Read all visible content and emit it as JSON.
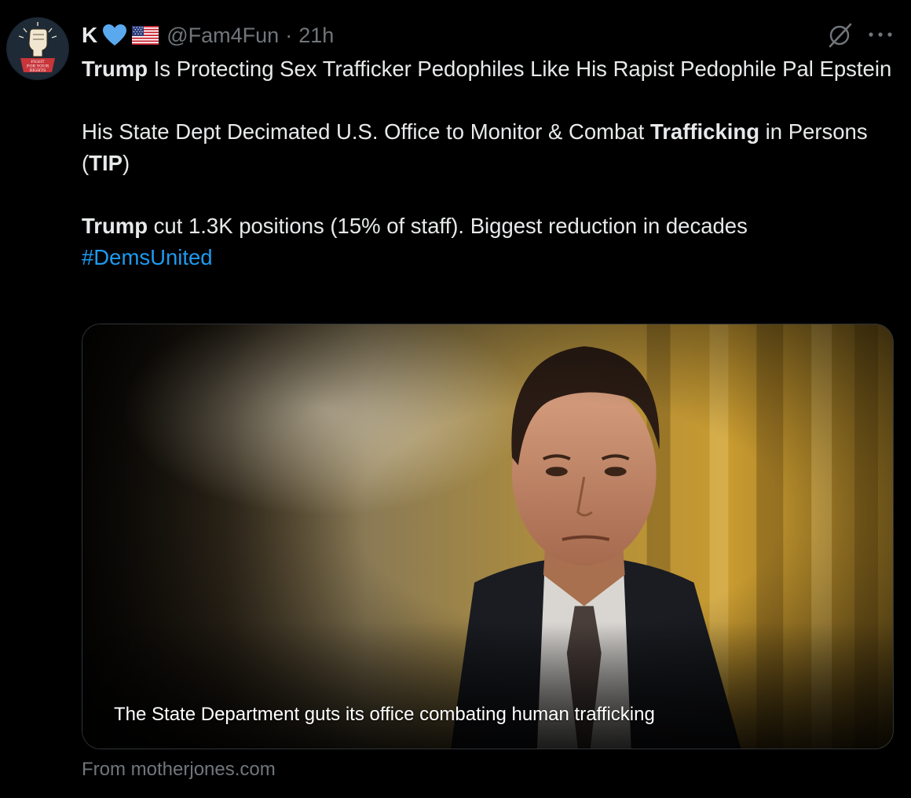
{
  "author": {
    "display_name": "K",
    "handle": "@Fam4Fun",
    "separator": "·",
    "time": "21h",
    "avatar_text": [
      "FIGHT",
      "FOR YOUR",
      "RIGHTS"
    ]
  },
  "tweet": {
    "line1_bold": "Trump",
    "line1_rest": " Is Protecting Sex Trafficker Pedophiles Like His Rapist Pedophile Pal Epstein",
    "line2_start": "His State Dept Decimated U.S. Office to Monitor & Combat ",
    "line2_bold": "Trafficking",
    "line2_mid": " in Persons (",
    "line2_bold2": "TIP",
    "line2_end": ")",
    "line3_bold": "Trump",
    "line3_rest": " cut 1.3K positions (15% of staff). Biggest reduction in decades",
    "hashtag": "#DemsUnited"
  },
  "card": {
    "caption": "The State Department guts its office combating human trafficking",
    "source": "From motherjones.com"
  },
  "colors": {
    "background": "#000000",
    "text": "#e7e9ea",
    "muted": "#71767b",
    "link": "#1d9bf0",
    "heart": "#5aa9ef",
    "border": "#2f3336"
  },
  "icons": {
    "heart": "blue-heart-icon",
    "flag": "us-flag-icon",
    "grok": "grok-icon",
    "more": "more-icon"
  }
}
